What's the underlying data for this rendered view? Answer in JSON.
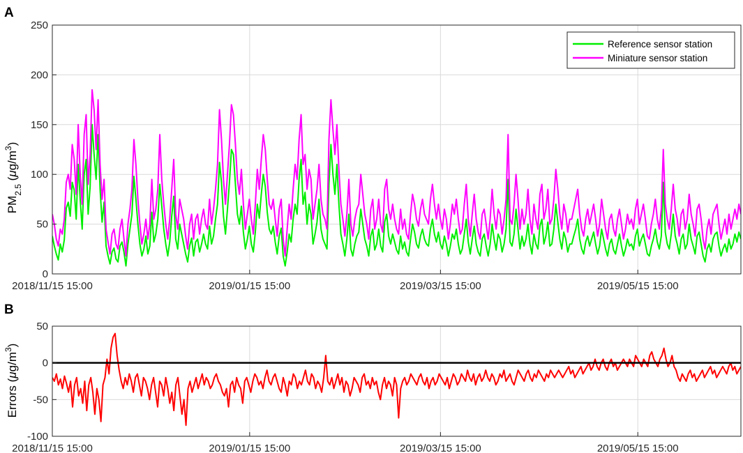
{
  "colors": {
    "reference": "#00ee00",
    "miniature": "#ff00ff",
    "errors": "#ff0000",
    "zero_line": "#000000",
    "grid": "#d9d9d9"
  },
  "chart_data": [
    {
      "panel": "A",
      "type": "line",
      "xlabel": "",
      "ylabel_parts": [
        "PM",
        "2.5",
        " (",
        "μ",
        "g/m",
        "3",
        ")"
      ],
      "ylim": [
        0,
        250
      ],
      "yticks": [
        "0",
        "50",
        "100",
        "150",
        "200",
        "250"
      ],
      "x_range": [
        "2018-11-15 15:00",
        "2019-06-16 12:00"
      ],
      "xticks": [
        "2018/11/15 15:00",
        "2019/01/15 15:00",
        "2019/03/15 15:00",
        "2019/05/15 15:00"
      ],
      "grid": true,
      "legend_position": "top-right",
      "series": [
        {
          "name": "Reference sensor station",
          "values": [
            38,
            28,
            20,
            14,
            30,
            22,
            34,
            66,
            72,
            58,
            92,
            84,
            55,
            110,
            75,
            45,
            100,
            115,
            60,
            88,
            150,
            120,
            95,
            140,
            85,
            52,
            72,
            28,
            18,
            10,
            22,
            26,
            15,
            12,
            28,
            32,
            22,
            8,
            30,
            45,
            60,
            98,
            75,
            50,
            30,
            18,
            25,
            38,
            20,
            28,
            62,
            32,
            40,
            55,
            90,
            68,
            45,
            30,
            18,
            32,
            58,
            78,
            35,
            25,
            50,
            40,
            30,
            20,
            12,
            28,
            36,
            18,
            32,
            35,
            22,
            30,
            40,
            30,
            25,
            48,
            30,
            38,
            55,
            70,
            112,
            92,
            58,
            40,
            65,
            92,
            125,
            120,
            90,
            60,
            50,
            68,
            42,
            25,
            35,
            48,
            30,
            22,
            42,
            70,
            56,
            80,
            100,
            88,
            62,
            45,
            40,
            48,
            32,
            20,
            38,
            46,
            18,
            8,
            22,
            40,
            32,
            55,
            70,
            60,
            95,
            115,
            70,
            82,
            50,
            70,
            60,
            30,
            40,
            52,
            75,
            45,
            35,
            30,
            25,
            90,
            130,
            100,
            80,
            110,
            70,
            40,
            30,
            18,
            35,
            60,
            25,
            18,
            30,
            38,
            42,
            65,
            50,
            35,
            28,
            18,
            38,
            45,
            24,
            30,
            45,
            28,
            22,
            52,
            60,
            38,
            30,
            40,
            32,
            24,
            20,
            38,
            25,
            32,
            22,
            18,
            35,
            50,
            42,
            30,
            26,
            38,
            45,
            35,
            30,
            28,
            45,
            55,
            40,
            32,
            42,
            30,
            25,
            38,
            30,
            18,
            28,
            40,
            35,
            45,
            30,
            20,
            25,
            40,
            55,
            32,
            20,
            35,
            48,
            30,
            22,
            18,
            35,
            40,
            28,
            18,
            30,
            50,
            35,
            24,
            40,
            35,
            22,
            30,
            45,
            95,
            32,
            28,
            40,
            65,
            45,
            25,
            38,
            28,
            35,
            50,
            30,
            20,
            40,
            30,
            25,
            48,
            55,
            30,
            38,
            52,
            28,
            30,
            45,
            70,
            52,
            35,
            25,
            42,
            35,
            22,
            30,
            30,
            38,
            45,
            55,
            35,
            25,
            20,
            32,
            38,
            28,
            35,
            42,
            30,
            20,
            28,
            45,
            35,
            25,
            18,
            30,
            35,
            24,
            20,
            30,
            40,
            28,
            18,
            25,
            35,
            28,
            30,
            24,
            38,
            45,
            28,
            35,
            40,
            30,
            20,
            18,
            28,
            35,
            45,
            32,
            25,
            38,
            92,
            42,
            30,
            25,
            40,
            60,
            38,
            30,
            20,
            35,
            40,
            25,
            30,
            50,
            35,
            28,
            20,
            38,
            42,
            30,
            18,
            12,
            25,
            30,
            22,
            35,
            40,
            42,
            28,
            18,
            25,
            30,
            22,
            35,
            25,
            30,
            40,
            32,
            42,
            35
          ]
        },
        {
          "name": "Miniature sensor station",
          "values": [
            60,
            50,
            35,
            28,
            45,
            40,
            55,
            92,
            100,
            85,
            130,
            115,
            80,
            150,
            100,
            70,
            140,
            160,
            90,
            120,
            185,
            165,
            125,
            175,
            110,
            75,
            95,
            45,
            32,
            20,
            40,
            45,
            30,
            25,
            45,
            55,
            35,
            18,
            50,
            65,
            85,
            135,
            110,
            75,
            50,
            30,
            40,
            55,
            35,
            50,
            95,
            55,
            65,
            85,
            140,
            95,
            70,
            50,
            35,
            55,
            85,
            115,
            60,
            45,
            75,
            65,
            55,
            38,
            25,
            50,
            60,
            35,
            55,
            60,
            40,
            55,
            65,
            50,
            45,
            75,
            50,
            65,
            85,
            110,
            165,
            135,
            95,
            70,
            100,
            130,
            170,
            160,
            130,
            95,
            80,
            105,
            70,
            45,
            60,
            75,
            55,
            40,
            70,
            105,
            85,
            115,
            140,
            125,
            95,
            70,
            65,
            75,
            55,
            38,
            65,
            75,
            35,
            18,
            45,
            70,
            55,
            85,
            110,
            95,
            135,
            160,
            110,
            120,
            85,
            105,
            95,
            55,
            70,
            85,
            110,
            75,
            60,
            55,
            45,
            135,
            175,
            145,
            120,
            150,
            105,
            70,
            55,
            38,
            60,
            95,
            50,
            38,
            55,
            65,
            70,
            100,
            80,
            60,
            50,
            35,
            65,
            75,
            45,
            55,
            75,
            50,
            42,
            85,
            95,
            65,
            55,
            70,
            55,
            45,
            40,
            65,
            45,
            55,
            40,
            35,
            60,
            80,
            70,
            55,
            48,
            65,
            75,
            60,
            55,
            50,
            75,
            90,
            70,
            55,
            70,
            55,
            45,
            65,
            55,
            35,
            50,
            70,
            60,
            75,
            55,
            40,
            45,
            70,
            90,
            55,
            38,
            60,
            80,
            55,
            42,
            35,
            60,
            65,
            50,
            35,
            55,
            85,
            60,
            45,
            65,
            60,
            40,
            55,
            75,
            140,
            55,
            50,
            70,
            100,
            75,
            45,
            65,
            50,
            60,
            85,
            55,
            40,
            70,
            55,
            45,
            80,
            90,
            55,
            65,
            85,
            50,
            55,
            75,
            105,
            85,
            60,
            45,
            70,
            60,
            42,
            55,
            55,
            65,
            75,
            85,
            60,
            45,
            38,
            55,
            65,
            50,
            60,
            70,
            55,
            38,
            50,
            75,
            60,
            45,
            35,
            55,
            60,
            45,
            38,
            55,
            65,
            50,
            35,
            45,
            60,
            50,
            55,
            45,
            65,
            75,
            50,
            60,
            70,
            55,
            38,
            35,
            50,
            60,
            75,
            55,
            45,
            65,
            125,
            70,
            55,
            45,
            65,
            90,
            65,
            55,
            38,
            60,
            65,
            45,
            55,
            80,
            60,
            50,
            38,
            65,
            70,
            55,
            35,
            25,
            45,
            55,
            40,
            60,
            65,
            70,
            50,
            35,
            45,
            55,
            40,
            60,
            45,
            55,
            65,
            55,
            70,
            60
          ]
        }
      ]
    },
    {
      "panel": "B",
      "type": "line",
      "xlabel": "",
      "ylabel_parts": [
        "Errors (",
        "μ",
        "g/m",
        "3",
        ")"
      ],
      "ylim": [
        -100,
        50
      ],
      "yticks": [
        "-100",
        "-50",
        "0",
        "50"
      ],
      "x_range": [
        "2018-11-15 15:00",
        "2019-06-16 12:00"
      ],
      "xticks": [
        "2018/11/15 15:00",
        "2019/01/15 15:00",
        "2019/03/15 15:00",
        "2019/05/15 15:00"
      ],
      "grid": true,
      "reference_line": 0,
      "series": [
        {
          "name": "",
          "values": [
            -20,
            -25,
            -15,
            -30,
            -22,
            -35,
            -18,
            -28,
            -40,
            -25,
            -60,
            -30,
            -20,
            -45,
            -35,
            -55,
            -25,
            -65,
            -30,
            -20,
            -40,
            -70,
            -35,
            -50,
            -80,
            -30,
            -20,
            5,
            -15,
            20,
            35,
            40,
            10,
            -10,
            -25,
            -35,
            -20,
            -30,
            -15,
            -25,
            -40,
            -20,
            -15,
            -30,
            -45,
            -20,
            -25,
            -35,
            -50,
            -30,
            -20,
            -40,
            -60,
            -25,
            -30,
            -45,
            -20,
            -35,
            -55,
            -40,
            -65,
            -30,
            -20,
            -45,
            -70,
            -50,
            -85,
            -35,
            -25,
            -40,
            -30,
            -20,
            -35,
            -25,
            -15,
            -30,
            -20,
            -25,
            -35,
            -30,
            -20,
            -15,
            -25,
            -30,
            -40,
            -45,
            -35,
            -60,
            -30,
            -25,
            -40,
            -20,
            -30,
            -35,
            -55,
            -25,
            -20,
            -30,
            -40,
            -25,
            -15,
            -20,
            -30,
            -25,
            -35,
            -20,
            -10,
            -25,
            -30,
            -20,
            -15,
            -25,
            -35,
            -40,
            -20,
            -30,
            -45,
            -25,
            -30,
            -15,
            -20,
            -35,
            -25,
            -30,
            -20,
            -10,
            -25,
            -30,
            -15,
            -20,
            -35,
            -25,
            -30,
            -40,
            -20,
            10,
            -25,
            -30,
            -20,
            -35,
            -25,
            -15,
            -30,
            -20,
            -40,
            -25,
            -30,
            -45,
            -35,
            -20,
            -25,
            -30,
            -40,
            -20,
            -15,
            -30,
            -25,
            -35,
            -20,
            -30,
            -25,
            -40,
            -50,
            -30,
            -20,
            -35,
            -25,
            -30,
            -45,
            -20,
            -30,
            -75,
            -35,
            -25,
            -20,
            -30,
            -25,
            -15,
            -20,
            -25,
            -30,
            -20,
            -15,
            -25,
            -30,
            -20,
            -35,
            -25,
            -20,
            -30,
            -25,
            -15,
            -20,
            -25,
            -30,
            -20,
            -35,
            -25,
            -15,
            -20,
            -30,
            -25,
            -15,
            -20,
            -25,
            -10,
            -20,
            -25,
            -15,
            -30,
            -20,
            -15,
            -25,
            -20,
            -10,
            -20,
            -25,
            -15,
            -20,
            -30,
            -25,
            -15,
            -20,
            -10,
            -25,
            -20,
            -15,
            -25,
            -30,
            -20,
            -10,
            -15,
            -20,
            -25,
            -15,
            -10,
            -20,
            -25,
            -15,
            -20,
            -10,
            -15,
            -20,
            -25,
            -15,
            -20,
            -10,
            -15,
            -20,
            -15,
            -10,
            -15,
            -20,
            -15,
            -10,
            -5,
            -15,
            -10,
            -20,
            -15,
            -10,
            -5,
            -15,
            -10,
            -5,
            0,
            -10,
            -5,
            5,
            -5,
            -10,
            0,
            5,
            -5,
            -10,
            0,
            5,
            -5,
            0,
            -10,
            -5,
            0,
            5,
            0,
            -5,
            5,
            0,
            -5,
            10,
            5,
            0,
            -5,
            5,
            0,
            -5,
            10,
            15,
            5,
            0,
            -5,
            5,
            10,
            20,
            5,
            -5,
            0,
            10,
            -5,
            -10,
            -20,
            -25,
            -15,
            -20,
            -25,
            -15,
            -10,
            -20,
            -15,
            -25,
            -20,
            -15,
            -10,
            -20,
            -15,
            -10,
            -5,
            -15,
            -10,
            -20,
            -15,
            -10,
            -5,
            -10,
            -15,
            -5,
            0,
            -10,
            -5,
            -15,
            -10,
            -5
          ]
        }
      ]
    }
  ]
}
